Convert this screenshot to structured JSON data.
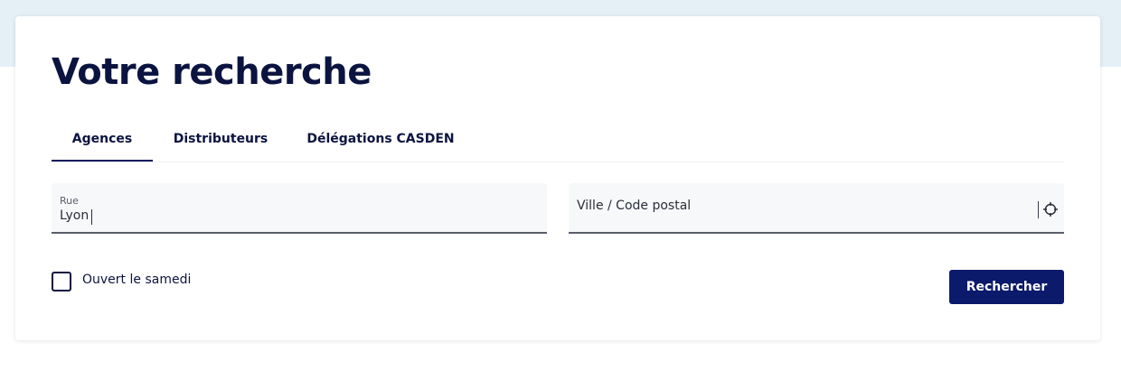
{
  "page": {
    "title": "Votre recherche"
  },
  "tabs": [
    {
      "label": "Agences",
      "active": true
    },
    {
      "label": "Distributeurs",
      "active": false
    },
    {
      "label": "Délégations CASDEN",
      "active": false
    }
  ],
  "fields": {
    "rue": {
      "label": "Rue",
      "value": "Lyon"
    },
    "ville": {
      "placeholder": "Ville / Code postal",
      "locate_icon": "crosshair-icon"
    }
  },
  "filters": {
    "ouvert_samedi": {
      "label": "Ouvert le samedi",
      "checked": false
    }
  },
  "actions": {
    "search_label": "Rechercher"
  },
  "colors": {
    "background_band": "#e4eff6",
    "primary": "#0b1a6b",
    "text": "#0b1440",
    "field_background": "#f7f8fa"
  }
}
